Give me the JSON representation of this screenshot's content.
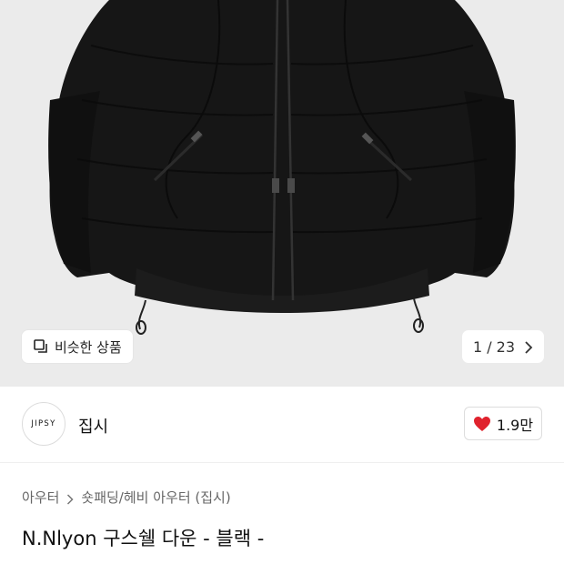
{
  "gallery": {
    "similar_label": "비슷한 상품",
    "pager_text": "1 / 23"
  },
  "brand": {
    "logo_text": "JIPSY",
    "name": "집시"
  },
  "like": {
    "count": "1.9만"
  },
  "breadcrumb": {
    "category": "아우터",
    "subcategory": "숏패딩/헤비 아우터 (집시)"
  },
  "product": {
    "title": "N.Nlyon 구스쉘 다운 - 블랙 -"
  },
  "colors": {
    "hero_bg": "#ebebeb",
    "heart": "#e0222d"
  }
}
